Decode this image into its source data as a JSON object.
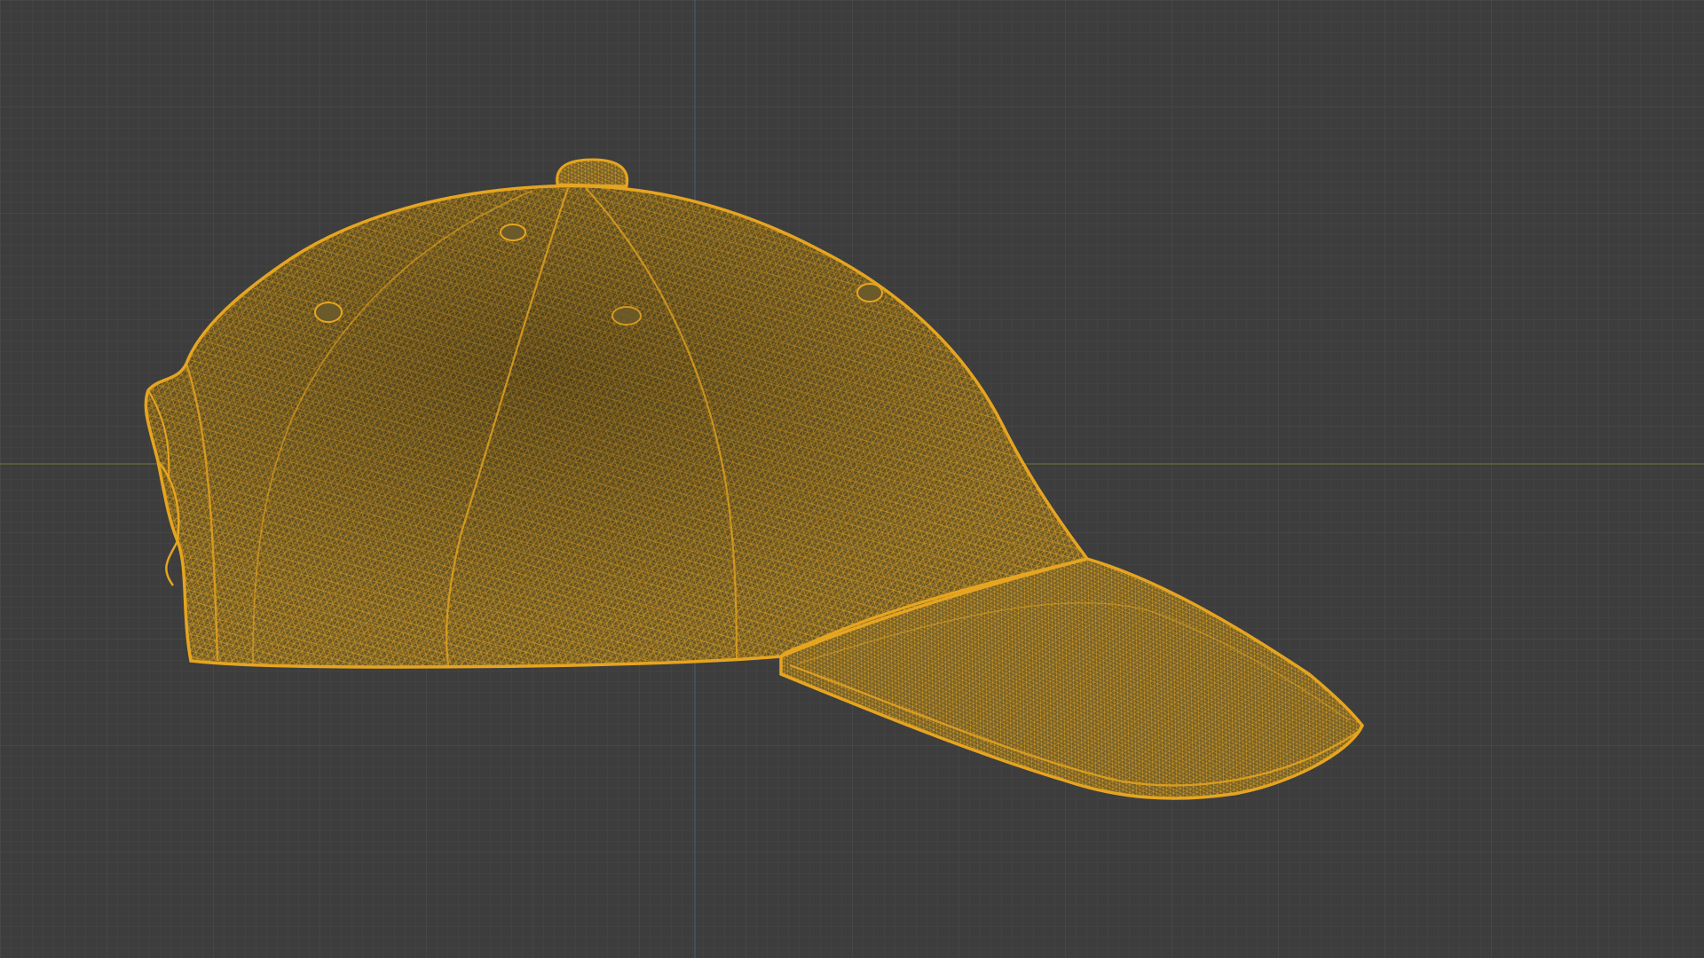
{
  "viewport": {
    "mode": "wireframe",
    "background_color": "#3d3d3d",
    "grid": {
      "visible": true,
      "minor_color": "#474747",
      "major_color": "#4e4e4e"
    },
    "axes": {
      "x_axis_color": "#6a6d3a",
      "z_axis_color": "#4a5a6e"
    }
  },
  "scene": {
    "objects": [
      {
        "name": "baseball-cap",
        "type": "mesh",
        "selected": true,
        "wire_color": "#e6a520",
        "tint_color": "#6b5a2a"
      }
    ]
  }
}
